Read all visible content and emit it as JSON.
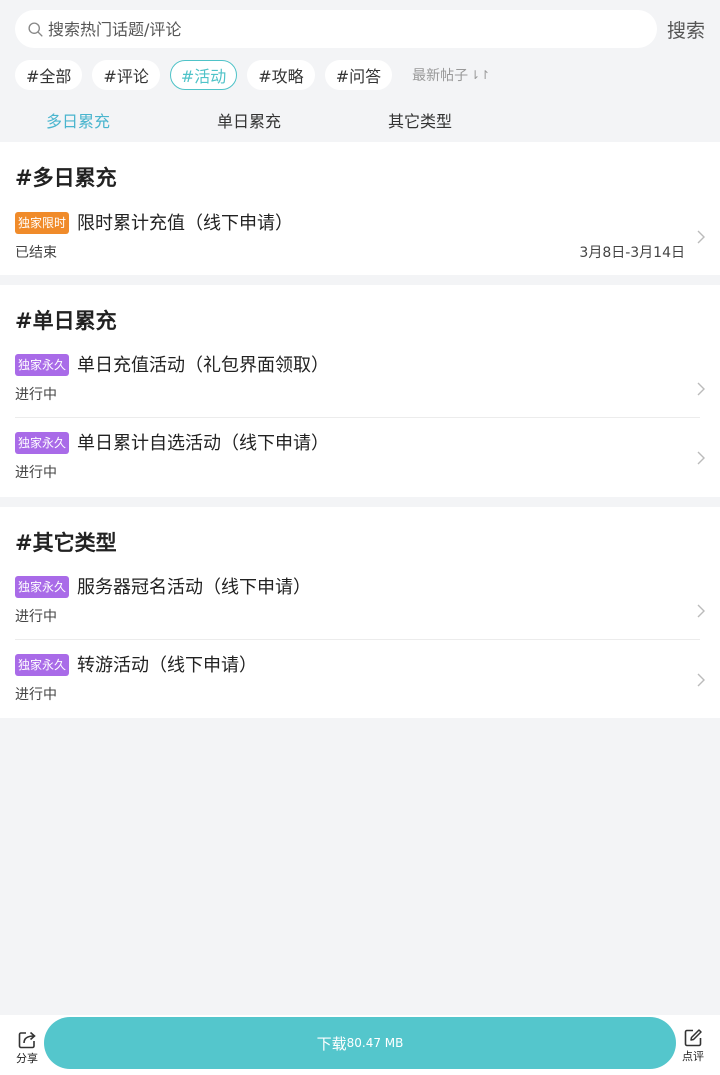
{
  "search": {
    "placeholder": "搜索热门话题/评论",
    "button": "搜索"
  },
  "tags": [
    "#全部",
    "#评论",
    "#活动",
    "#攻略",
    "#问答"
  ],
  "active_tag": "#活动",
  "sort": {
    "label": "最新帖子",
    "arrow": "⇂↾"
  },
  "subtabs": [
    "多日累充",
    "单日累充",
    "其它类型"
  ],
  "sections": [
    {
      "title": "#多日累充",
      "items": [
        {
          "badge": "独家限时",
          "title": "限时累计充值（线下申请）",
          "status": "已结束",
          "date": "3月8日-3月14日"
        }
      ]
    },
    {
      "title": "#单日累充",
      "items": [
        {
          "badge": "独家永久",
          "title": "单日充值活动（礼包界面领取）",
          "status": "进行中"
        },
        {
          "badge": "独家永久",
          "title": "单日累计自选活动（线下申请）",
          "status": "进行中"
        }
      ]
    },
    {
      "title": "#其它类型",
      "items": [
        {
          "badge": "独家永久",
          "title": "服务器冠名活动（线下申请）",
          "status": "进行中"
        },
        {
          "badge": "独家永久",
          "title": "转游活动（线下申请）",
          "status": "进行中"
        }
      ]
    }
  ],
  "bottom": {
    "share": "分享",
    "download_label": "下载",
    "download_size": "80.47 MB",
    "rate": "点评"
  },
  "colors": {
    "accent": "#4fc3c8",
    "orange_badge": "#f08b2a",
    "purple_badge": "#a96be8",
    "download_bg": "#54c6cc"
  }
}
